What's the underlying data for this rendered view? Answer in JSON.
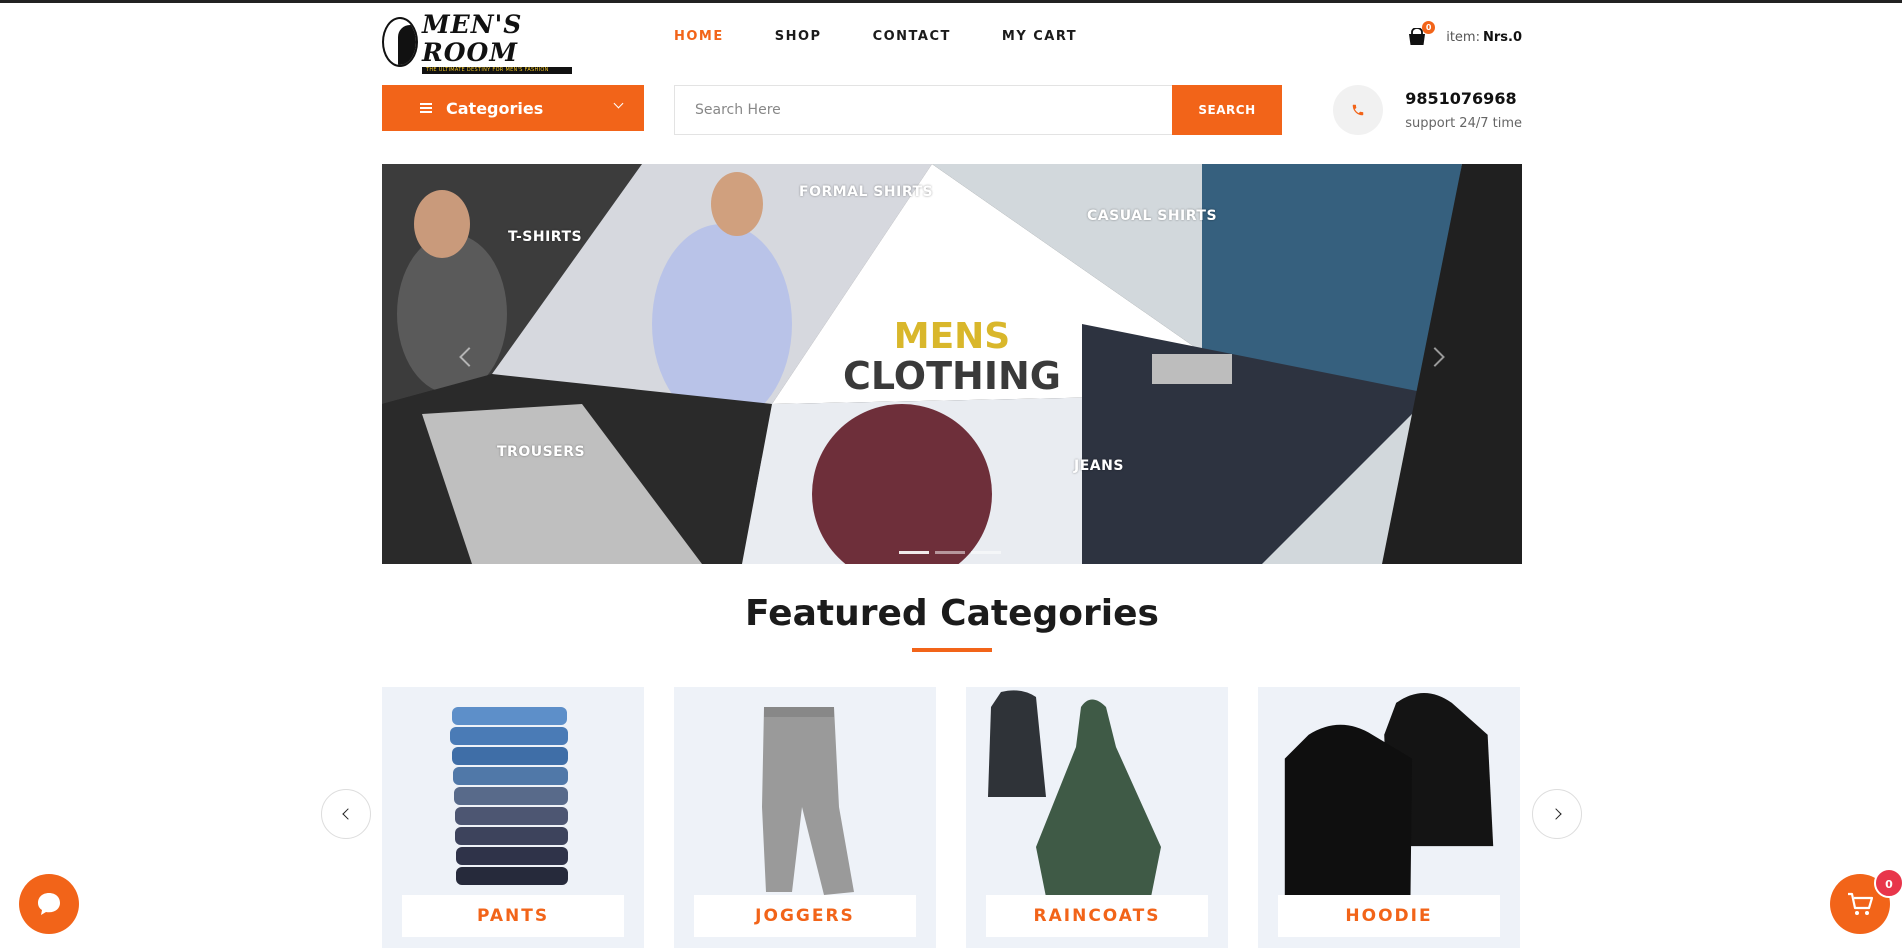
{
  "brand": {
    "logo_text": "MEN'S ROOM",
    "tagline": "THE ULTIMATE DESTINY FOR MEN'S FASHION"
  },
  "nav": {
    "home": "HOME",
    "shop": "SHOP",
    "contact": "CONTACT",
    "cart": "MY CART"
  },
  "mini_cart": {
    "count": "0",
    "item_label": "item:",
    "total": "Nrs.0"
  },
  "categories_button": "Categories",
  "search": {
    "placeholder": "Search Here",
    "button": "SEARCH"
  },
  "support": {
    "phone": "9851076968",
    "hours": "support 24/7 time"
  },
  "hero": {
    "labels": {
      "tshirts": "T-SHIRTS",
      "formal": "FORMAL SHIRTS",
      "casual": "CASUAL SHIRTS",
      "trousers": "TROUSERS",
      "jeans": "JEANS"
    },
    "title_line1": "MENS",
    "title_line2": "CLOTHING",
    "slide_count": 3,
    "active_slide": 1
  },
  "featured": {
    "title": "Featured Categories",
    "items": [
      {
        "label": "PANTS"
      },
      {
        "label": "JOGGERS"
      },
      {
        "label": "RAINCOATS"
      },
      {
        "label": "HOODIE"
      }
    ]
  },
  "floating_cart": {
    "count": "0"
  },
  "colors": {
    "accent": "#f26419",
    "badge_red": "#e8364b",
    "card_bg": "#eef2f8"
  },
  "icons": [
    "shopping-bag-icon",
    "hamburger-icon",
    "chevron-down-icon",
    "phone-icon",
    "chevron-left-icon",
    "chevron-right-icon",
    "chat-icon",
    "cart-icon"
  ]
}
